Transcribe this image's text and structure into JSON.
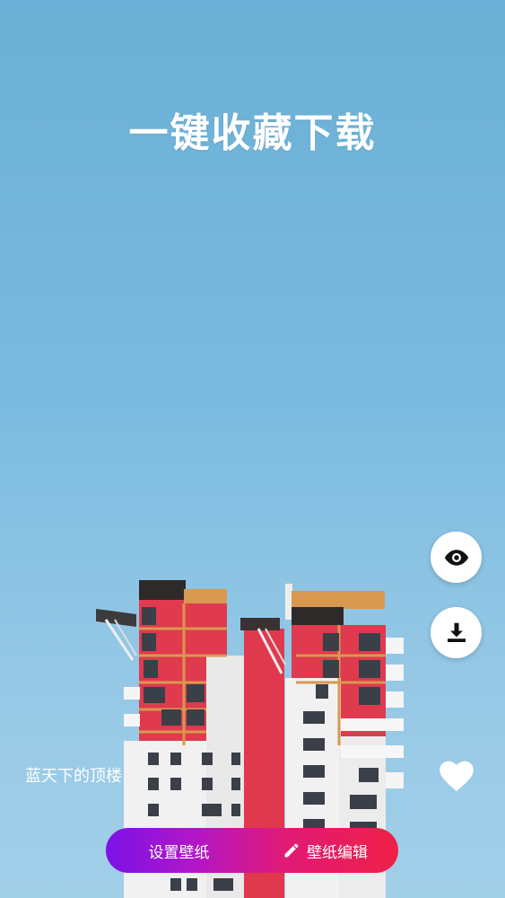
{
  "headline": "一键收藏下载",
  "wallpaper": {
    "title": "蓝天下的顶楼"
  },
  "actions": {
    "set_wallpaper": "设置壁纸",
    "edit_wallpaper": "壁纸编辑"
  },
  "icons": {
    "preview": "eye-icon",
    "download": "download-icon",
    "favorite": "heart-icon",
    "edit": "pencil-icon"
  },
  "colors": {
    "sky_top": "#6aafd5",
    "sky_bottom": "#a2cfe8",
    "gradient_start": "#7b12e6",
    "gradient_end": "#f02046",
    "building_accent": "#e0384d"
  }
}
